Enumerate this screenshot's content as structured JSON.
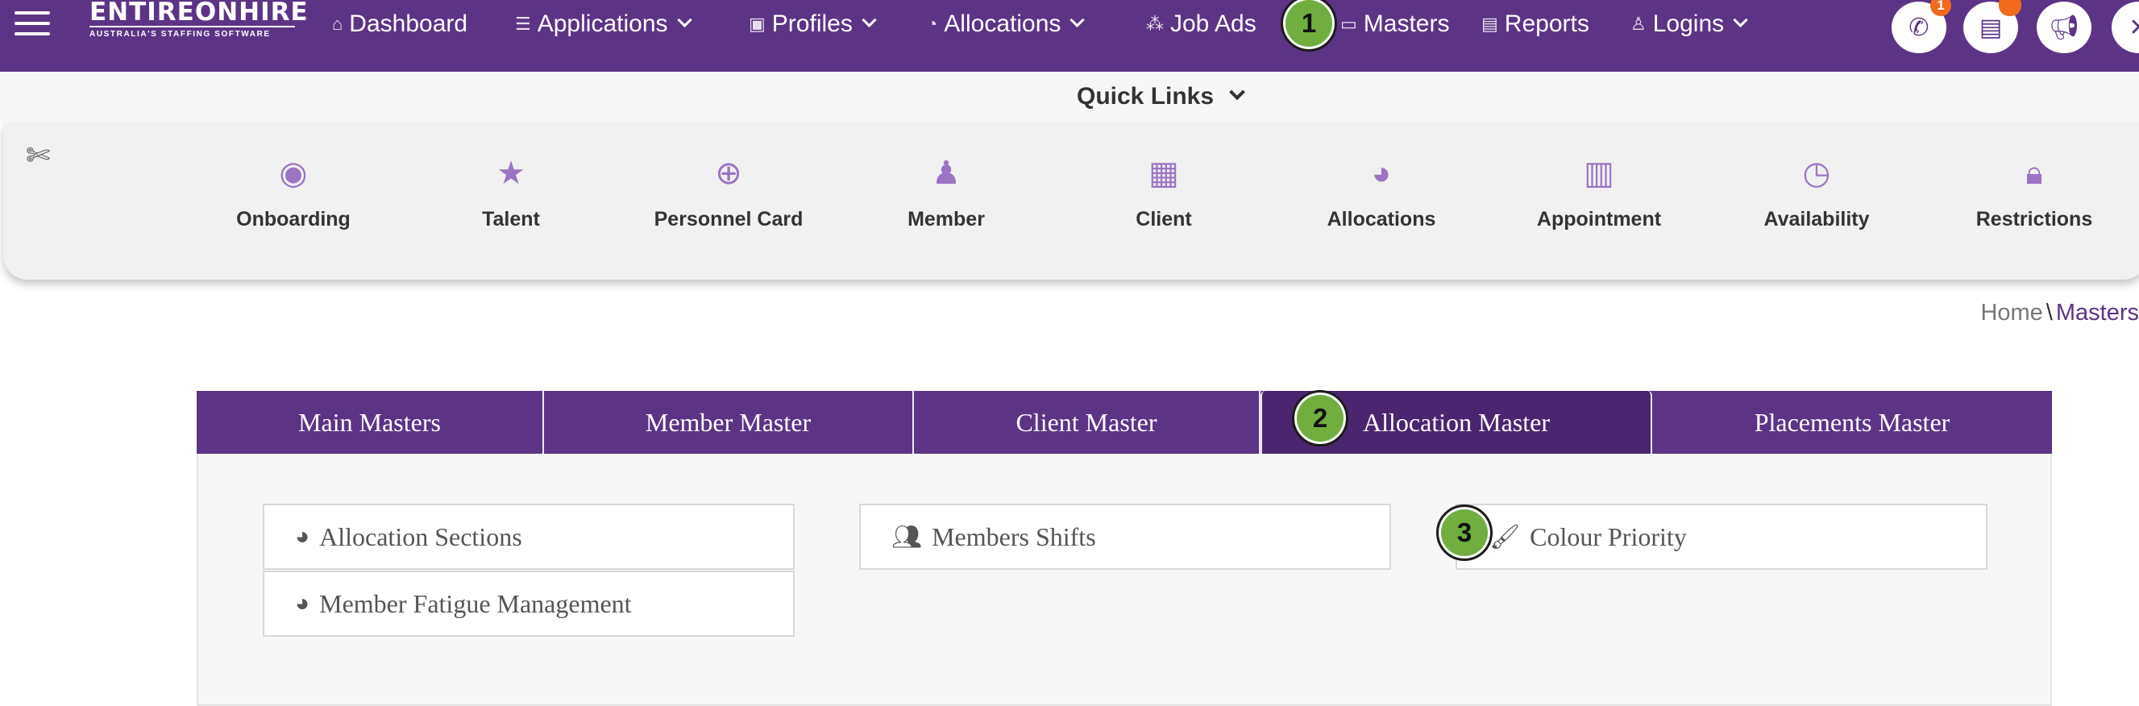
{
  "header": {
    "logo_main": "ENTIREONHIRE",
    "logo_sub": "AUSTRALIA'S STAFFING SOFTWARE",
    "nav": [
      {
        "label": "Dashboard",
        "icon": "home-icon"
      },
      {
        "label": "Applications",
        "icon": "list-icon"
      },
      {
        "label": "Profiles",
        "icon": "profile-card-icon"
      },
      {
        "label": "Allocations",
        "icon": "pie-icon"
      },
      {
        "label": "Job Ads",
        "icon": "network-icon"
      },
      {
        "label": "Masters",
        "icon": "folder-icon"
      },
      {
        "label": "Reports",
        "icon": "document-icon"
      },
      {
        "label": "Logins",
        "icon": "user-icon"
      }
    ],
    "phone_badge": "1"
  },
  "steps": [
    "1",
    "2",
    "3"
  ],
  "quick_links": {
    "title": "Quick Links",
    "items": [
      {
        "label": "Onboarding",
        "icon": "user-circle-icon"
      },
      {
        "label": "Talent",
        "icon": "star-icon"
      },
      {
        "label": "Personnel Card",
        "icon": "search-plus-icon"
      },
      {
        "label": "Member",
        "icon": "person-icon"
      },
      {
        "label": "Client",
        "icon": "building-icon"
      },
      {
        "label": "Allocations",
        "icon": "pie-chart-icon"
      },
      {
        "label": "Appointment",
        "icon": "calendar-icon"
      },
      {
        "label": "Availability",
        "icon": "clock-icon"
      },
      {
        "label": "Restrictions",
        "icon": "lock-icon"
      }
    ]
  },
  "breadcrumb": {
    "home": "Home",
    "sep": "\\",
    "current": "Masters"
  },
  "tabs": [
    "Main Masters",
    "Member Master",
    "Client Master",
    "Allocation Master",
    "Placements Master"
  ],
  "active_tab": "Allocation Master",
  "items": [
    {
      "label": "Allocation Sections",
      "icon": "pie-chart-icon"
    },
    {
      "label": "Members Shifts",
      "icon": "users-icon"
    },
    {
      "label": "Colour Priority",
      "icon": "paint-brush-icon"
    },
    {
      "label": "Member Fatigue Management",
      "icon": "pie-chart-icon"
    }
  ],
  "colors": {
    "brand": "#5c3486",
    "active_tab": "#4a2670",
    "step_marker": "#6fae3f",
    "quick_icon": "#9b74c4",
    "badge": "#f26b1d"
  }
}
